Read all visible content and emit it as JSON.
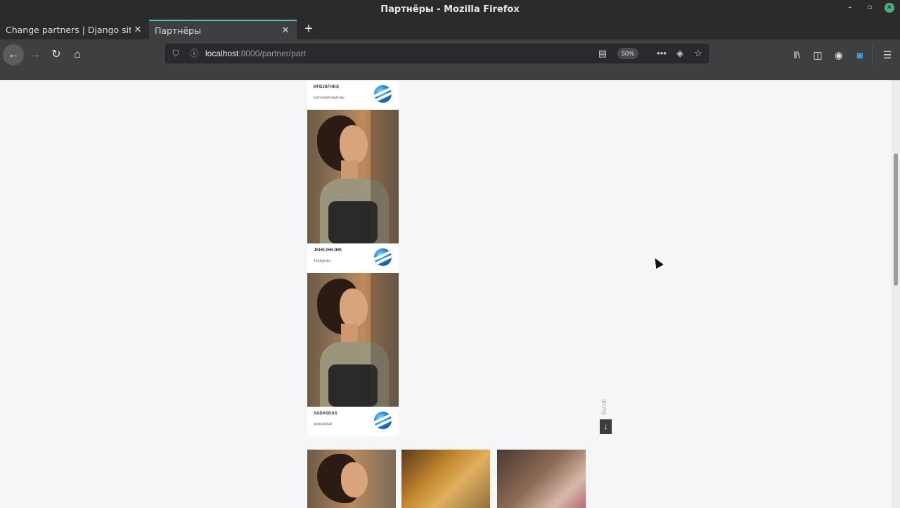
{
  "window": {
    "title": "Партнёры - Mozilla Firefox"
  },
  "tabs": [
    {
      "label": "Change partners | Django site adm",
      "active": false
    },
    {
      "label": "Партнёры",
      "active": true
    }
  ],
  "navigation": {
    "url_host": "localhost",
    "url_path": ":8000/partner/part",
    "zoom": "50%"
  },
  "partners": [
    {
      "name": "KFDJSFHKS",
      "description": "fdsfhsdskjfhsdkjfhsdkj"
    },
    {
      "name": "JKHKJHKJHK",
      "description": "fhfsdkjshdks"
    },
    {
      "name": "SADASDAS",
      "description": "jdkdfjsdkfjsdk"
    }
  ],
  "scroll_indicator": {
    "label": "Scroll",
    "arrow": "↓"
  },
  "icons": {
    "back": "back-arrow-icon",
    "forward": "forward-arrow-icon",
    "reload": "reload-icon",
    "home": "home-icon",
    "shield": "tracking-shield-icon",
    "info": "info-icon",
    "reader": "reader-view-icon",
    "more": "more-dots-icon",
    "pocket": "pocket-icon",
    "bookmark": "bookmark-star-icon",
    "library": "library-icon",
    "sidebar": "sidebar-icon",
    "account": "account-icon",
    "screenshot": "screenshot-icon",
    "menu": "hamburger-menu-icon"
  },
  "colors": {
    "chrome_dark": "#2b2b2b",
    "toolbar": "#3d3f41",
    "active_tab_accent": "#4ec3c2",
    "page_bg": "#f5f6f7"
  }
}
